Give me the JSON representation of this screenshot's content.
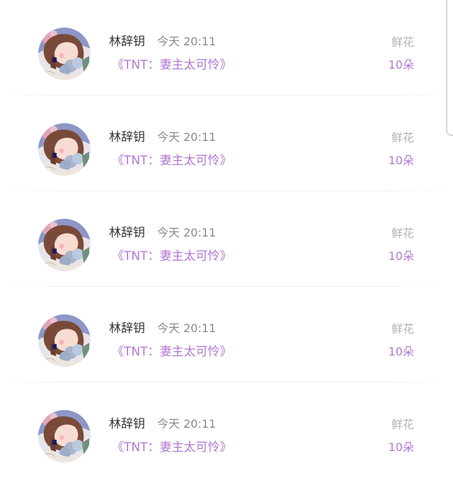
{
  "rows": [
    {
      "username": "林辞钥",
      "time": "今天 20:11",
      "book": "《TNT：妻主太可怜》",
      "gift_type": "鲜花",
      "gift_count": "10朵"
    },
    {
      "username": "林辞钥",
      "time": "今天 20:11",
      "book": "《TNT：妻主太可怜》",
      "gift_type": "鲜花",
      "gift_count": "10朵"
    },
    {
      "username": "林辞钥",
      "time": "今天 20:11",
      "book": "《TNT：妻主太可怜》",
      "gift_type": "鲜花",
      "gift_count": "10朵"
    },
    {
      "username": "林辞钥",
      "time": "今天 20:11",
      "book": "《TNT：妻主太可怜》",
      "gift_type": "鲜花",
      "gift_count": "10朵"
    },
    {
      "username": "林辞钥",
      "time": "今天 20:11",
      "book": "《TNT：妻主太可怜》",
      "gift_type": "鲜花",
      "gift_count": "10朵"
    }
  ],
  "colors": {
    "accent": "#b278d2",
    "username": "#333333",
    "time": "#8a8a8a",
    "gift_type": "#b4b4b4"
  }
}
